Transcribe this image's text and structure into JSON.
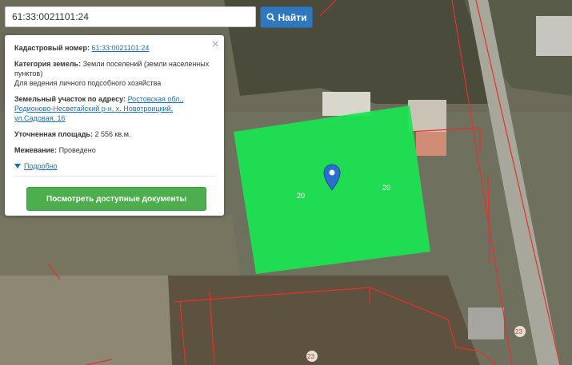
{
  "search": {
    "value": "61:33:0021101:24",
    "button_label": "Найти",
    "icon": "search-icon"
  },
  "panel": {
    "cadastral_label": "Кадастровый номер:",
    "cadastral_value": "61:33:0021101:24",
    "category_label": "Категория земель:",
    "category_value": "Земли поселений (земли населенных пунктов)",
    "category_use": "Для ведения личного подсобного хозяйства",
    "address_label": "Земельный участок по адресу:",
    "address_line1": "Ростовская обл.,",
    "address_line2": "Родионово-Несветайский р-н, х. Новотроицкий,",
    "address_line3": "ул.Садовая, 16",
    "area_label": "Уточненная площадь:",
    "area_value": "2 556 кв.м.",
    "survey_label": "Межевание:",
    "survey_value": "Проведено",
    "more_label": "Подробно",
    "button_label": "Посмотреть доступные документы"
  },
  "map": {
    "parcel_labels": [
      "20",
      "20",
      "23",
      "23"
    ],
    "parcel_color": "#19e553",
    "marker_color": "#2a6fd0",
    "boundary_color": "#e8302a"
  }
}
